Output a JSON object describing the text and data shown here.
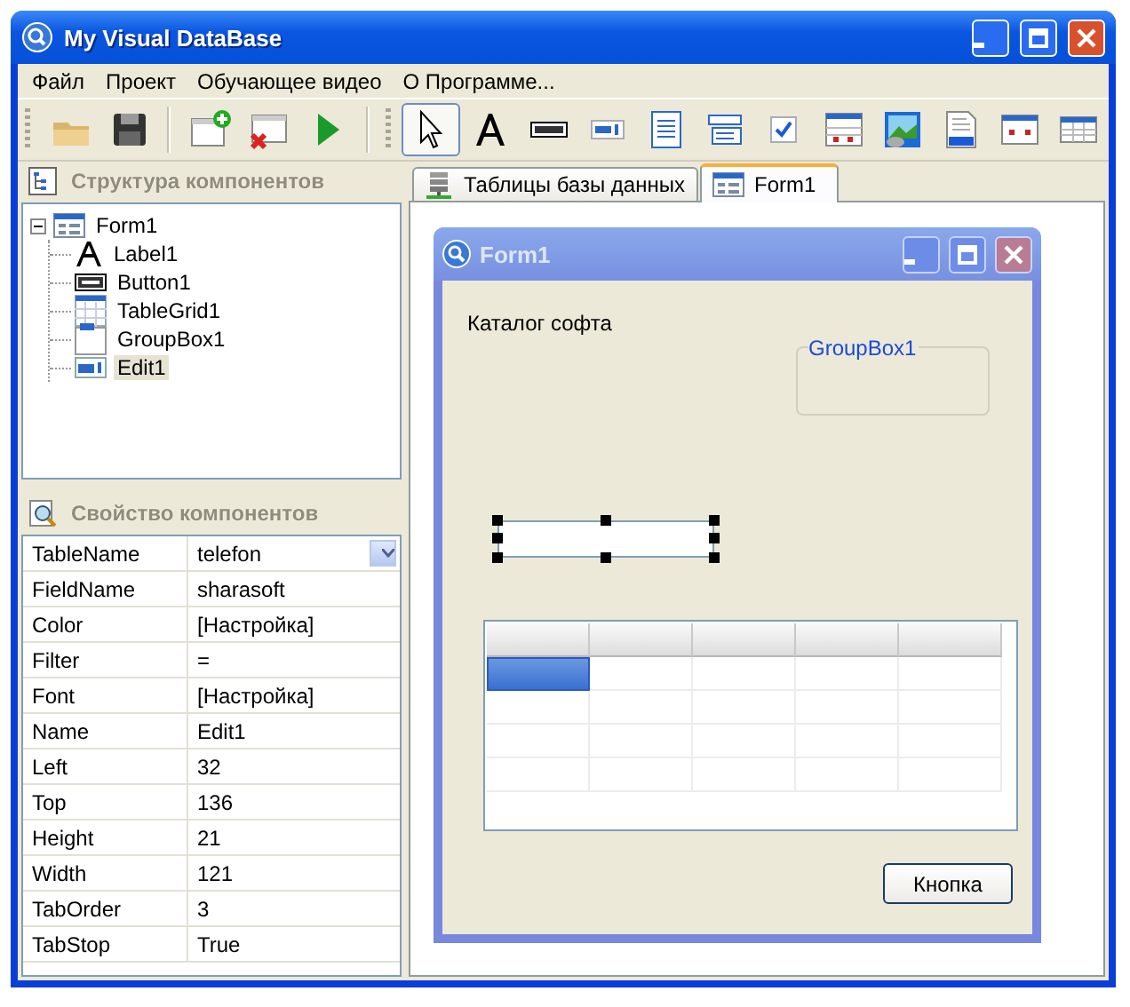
{
  "window": {
    "title": "My Visual DataBase"
  },
  "menu": [
    {
      "label": "Файл"
    },
    {
      "label": "Проект"
    },
    {
      "label": "Обучающее видео"
    },
    {
      "label": "О Программе..."
    }
  ],
  "structure_panel": {
    "title": "Структура компонентов",
    "tree": [
      {
        "label": "Form1",
        "kind": "form",
        "expanded": true,
        "selected": false,
        "children": [
          {
            "label": "Label1",
            "kind": "label",
            "selected": false
          },
          {
            "label": "Button1",
            "kind": "button",
            "selected": false
          },
          {
            "label": "TableGrid1",
            "kind": "grid",
            "selected": false
          },
          {
            "label": "GroupBox1",
            "kind": "groupbox",
            "selected": false
          },
          {
            "label": "Edit1",
            "kind": "edit",
            "selected": true
          }
        ]
      }
    ]
  },
  "properties_panel": {
    "title": "Свойство компонентов",
    "rows": [
      {
        "name": "TableName",
        "value": "telefon",
        "kind": "dropdown"
      },
      {
        "name": "FieldName",
        "value": "sharasoft",
        "kind": "text"
      },
      {
        "name": "Color",
        "value": "[Настройка]",
        "kind": "text"
      },
      {
        "name": "Filter",
        "value": "=",
        "kind": "text"
      },
      {
        "name": "Font",
        "value": "[Настройка]",
        "kind": "text"
      },
      {
        "name": "Name",
        "value": "Edit1",
        "kind": "text"
      },
      {
        "name": "Left",
        "value": "32",
        "kind": "text"
      },
      {
        "name": "Top",
        "value": "136",
        "kind": "text"
      },
      {
        "name": "Height",
        "value": "21",
        "kind": "text"
      },
      {
        "name": "Width",
        "value": "121",
        "kind": "text"
      },
      {
        "name": "TabOrder",
        "value": "3",
        "kind": "text"
      },
      {
        "name": "TabStop",
        "value": "True",
        "kind": "text"
      }
    ]
  },
  "tabs": [
    {
      "label": "Таблицы базы данных",
      "kind": "tables",
      "selected": false
    },
    {
      "label": "Form1",
      "kind": "form",
      "selected": true
    }
  ],
  "designer": {
    "form_title": "Form1",
    "label": "Каталог софта",
    "groupbox": "GroupBox1",
    "edit_selected": true,
    "grid": {
      "rows": [
        {
          "cells": [
            {
              "selected": true
            },
            {
              "selected": false
            },
            {
              "selected": false
            },
            {
              "selected": false
            },
            {
              "selected": false
            }
          ]
        },
        {
          "cells": [
            {
              "selected": false
            },
            {
              "selected": false
            },
            {
              "selected": false
            },
            {
              "selected": false
            },
            {
              "selected": false
            }
          ]
        },
        {
          "cells": [
            {
              "selected": false
            },
            {
              "selected": false
            },
            {
              "selected": false
            },
            {
              "selected": false
            },
            {
              "selected": false
            }
          ]
        },
        {
          "cells": [
            {
              "selected": false
            },
            {
              "selected": false
            },
            {
              "selected": false
            },
            {
              "selected": false
            },
            {
              "selected": false
            }
          ]
        }
      ]
    },
    "button": "Кнопка"
  }
}
